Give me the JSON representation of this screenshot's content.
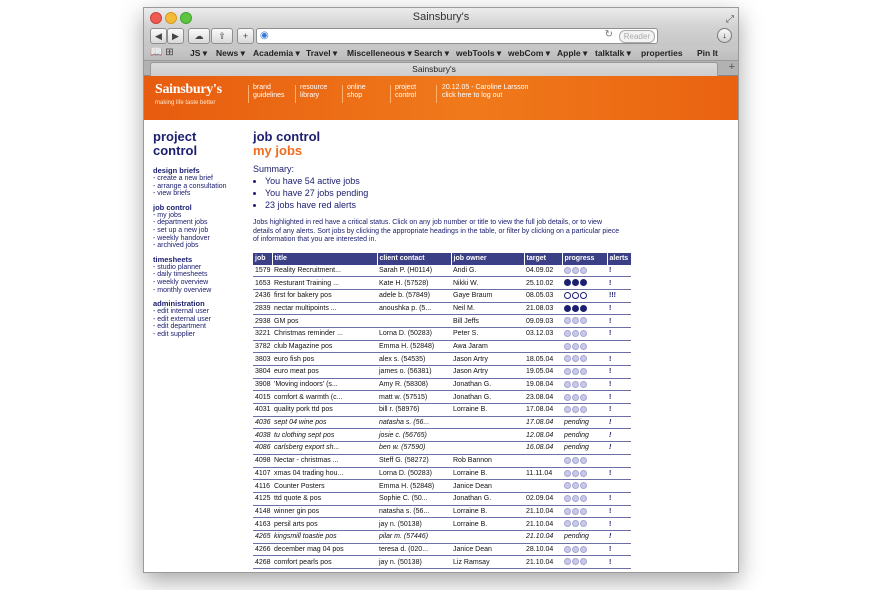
{
  "window": {
    "title": "Sainsbury's"
  },
  "toolbar": {
    "reader_label": "Reader"
  },
  "bookmarks": [
    "JS",
    "News",
    "Academia",
    "Travel",
    "Miscelleneous",
    "Search",
    "webTools",
    "webCom",
    "Apple",
    "talktalk",
    "properties",
    "Pin It"
  ],
  "tab": {
    "title": "Sainsbury's"
  },
  "banner": {
    "logo": "Sainsbury's",
    "tagline": "making life taste better",
    "nav": [
      {
        "line1": "brand",
        "line2": "guidelines"
      },
      {
        "line1": "resource",
        "line2": "library"
      },
      {
        "line1": "online",
        "line2": "shop"
      },
      {
        "line1": "project",
        "line2": "control"
      }
    ],
    "session_line1": "20.12.05 - Caroline Larsson",
    "session_line2": "click here to log out"
  },
  "sidebar": {
    "title_line1": "project",
    "title_line2": "control",
    "sections": [
      {
        "heading": "design briefs",
        "links": [
          "- create a new brief",
          "- arrange a consultation",
          "- view briefs"
        ]
      },
      {
        "heading": "job control",
        "links": [
          "- my jobs",
          "- department jobs",
          "- set up a new job",
          "- weekly handover",
          "- archived jobs"
        ]
      },
      {
        "heading": "timesheets",
        "links": [
          "- studio planner",
          "- daily timesheets",
          "- weekly overview",
          "- monthly overview"
        ]
      },
      {
        "heading": "administration",
        "links": [
          "- edit internal user",
          "- edit external user",
          "- edit department",
          "- edit supplier"
        ]
      }
    ]
  },
  "main": {
    "title": "job control",
    "subtitle": "my jobs",
    "summary_title": "Summary:",
    "summary_items": [
      "You have 54 active jobs",
      "You have 27 jobs pending",
      "23 jobs have red alerts"
    ],
    "intro": "Jobs highlighted in red have a critical status. Click on any job number or title to view the full job details, or to view details of any alerts. Sort jobs by clicking the appropriate headings in the table, or filter by clicking on a particular piece of information that you are interested in."
  },
  "table": {
    "headers": [
      "job",
      "title",
      "client contact",
      "job owner",
      "target",
      "progress",
      "alerts"
    ],
    "rows": [
      {
        "job": "1579",
        "title": "Reality Recruitment...",
        "client": "Sarah P. (H0114)",
        "owner": "Andi G.",
        "target": "04.09.02",
        "progress": "dots",
        "p": [
          0,
          0,
          0
        ],
        "alerts": "!"
      },
      {
        "job": "1653",
        "title": "Resturant Training ...",
        "client": "Kate H. (57528)",
        "owner": "Nikki W.",
        "target": "25.10.02",
        "progress": "dots",
        "p": [
          1,
          1,
          1
        ],
        "alerts": "!"
      },
      {
        "job": "2436",
        "title": "first for bakery pos",
        "client": "adele b. (57849)",
        "owner": "Gaye Braum",
        "target": "08.05.03",
        "progress": "dots",
        "p": [
          2,
          2,
          2
        ],
        "alerts": "!!!"
      },
      {
        "job": "2839",
        "title": "nectar multipoints ...",
        "client": "anoushka p. (5...",
        "owner": "Neil M.",
        "target": "21.08.03",
        "progress": "dots",
        "p": [
          1,
          1,
          1
        ],
        "alerts": "!"
      },
      {
        "job": "2938",
        "title": "GM pos",
        "client": "",
        "owner": "Bill Jeffs",
        "target": "09.09.03",
        "progress": "dots",
        "p": [
          0,
          0,
          0
        ],
        "alerts": "!"
      },
      {
        "job": "3221",
        "title": "Christmas reminder ...",
        "client": "Lorna D. (50283)",
        "owner": "Peter S.",
        "target": "03.12.03",
        "progress": "dots",
        "p": [
          0,
          0,
          0
        ],
        "alerts": "!"
      },
      {
        "job": "3782",
        "title": "club Magazine pos",
        "client": "Emma H. (52848)",
        "owner": "Awa Jaram",
        "target": "",
        "progress": "dots",
        "p": [
          0,
          0,
          0
        ],
        "alerts": ""
      },
      {
        "job": "3803",
        "title": "euro fish pos",
        "client": "alex s. (54535)",
        "owner": "Jason Artry",
        "target": "18.05.04",
        "progress": "dots",
        "p": [
          0,
          0,
          0
        ],
        "alerts": "!"
      },
      {
        "job": "3804",
        "title": "euro meat pos",
        "client": "james o. (56381)",
        "owner": "Jason Artry",
        "target": "19.05.04",
        "progress": "dots",
        "p": [
          0,
          0,
          0
        ],
        "alerts": "!"
      },
      {
        "job": "3908",
        "title": "'Moving indoors' (s...",
        "client": "Amy R. (58308)",
        "owner": "Jonathan G.",
        "target": "19.08.04",
        "progress": "dots",
        "p": [
          0,
          0,
          0
        ],
        "alerts": "!"
      },
      {
        "job": "4015",
        "title": "comfort & warmth (c...",
        "client": "matt w. (57515)",
        "owner": "Jonathan G.",
        "target": "23.08.04",
        "progress": "dots",
        "p": [
          0,
          0,
          0
        ],
        "alerts": "!"
      },
      {
        "job": "4031",
        "title": "quality pork ttd pos",
        "client": "bill r. (58976)",
        "owner": "Lorraine B.",
        "target": "17.08.04",
        "progress": "dots",
        "p": [
          0,
          0,
          0
        ],
        "alerts": "!"
      },
      {
        "job": "4036",
        "title": "sept 04 wine pos",
        "client": "natasha s. (56...",
        "owner": "",
        "target": "17.08.04",
        "progress": "pending",
        "alerts": "!",
        "italic": true
      },
      {
        "job": "4038",
        "title": "tu clothing sept pos",
        "client": "josie c. (56765)",
        "owner": "",
        "target": "12.08.04",
        "progress": "pending",
        "alerts": "!",
        "italic": true
      },
      {
        "job": "4086",
        "title": "carlsberg export sh...",
        "client": "ben w. (57590)",
        "owner": "",
        "target": "16.08.04",
        "progress": "pending",
        "alerts": "!",
        "italic": true
      },
      {
        "job": "4098",
        "title": "Nectar - christmas ...",
        "client": "Steff G. (58272)",
        "owner": "Rob Bannon",
        "target": "",
        "progress": "dots",
        "p": [
          0,
          0,
          0
        ],
        "alerts": ""
      },
      {
        "job": "4107",
        "title": "xmas 04 trading hou...",
        "client": "Lorna D. (50283)",
        "owner": "Lorraine B.",
        "target": "11.11.04",
        "progress": "dots",
        "p": [
          0,
          0,
          0
        ],
        "alerts": "!"
      },
      {
        "job": "4116",
        "title": "Counter Posters",
        "client": "Emma H. (52848)",
        "owner": "Janice Dean",
        "target": "",
        "progress": "dots",
        "p": [
          0,
          0,
          0
        ],
        "alerts": ""
      },
      {
        "job": "4125",
        "title": "ttd quote & pos",
        "client": "Sophie C. (50...",
        "owner": "Jonathan G.",
        "target": "02.09.04",
        "progress": "dots",
        "p": [
          0,
          0,
          0
        ],
        "alerts": "!"
      },
      {
        "job": "4148",
        "title": "winner gin pos",
        "client": "natasha s. (56...",
        "owner": "Lorraine B.",
        "target": "21.10.04",
        "progress": "dots",
        "p": [
          0,
          0,
          0
        ],
        "alerts": "!"
      },
      {
        "job": "4163",
        "title": "persil arts pos",
        "client": "jay n. (50138)",
        "owner": "Lorraine B.",
        "target": "21.10.04",
        "progress": "dots",
        "p": [
          0,
          0,
          0
        ],
        "alerts": "!"
      },
      {
        "job": "4265",
        "title": "kingsmill toastie pos",
        "client": "pilar m. (57446)",
        "owner": "",
        "target": "21.10.04",
        "progress": "pending",
        "alerts": "!",
        "italic": true
      },
      {
        "job": "4266",
        "title": "december mag 04 pos",
        "client": "teresa d. (020...",
        "owner": "Janice Dean",
        "target": "28.10.04",
        "progress": "dots",
        "p": [
          0,
          0,
          0
        ],
        "alerts": "!"
      },
      {
        "job": "4268",
        "title": "comfort pearls pos",
        "client": "jay n. (50138)",
        "owner": "Liz Ramsay",
        "target": "21.10.04",
        "progress": "dots",
        "p": [
          0,
          0,
          0
        ],
        "alerts": "!"
      }
    ]
  },
  "colors": {
    "brand_orange": "#f07a1b",
    "navy": "#1d2070",
    "table_header": "#3b3f86"
  }
}
